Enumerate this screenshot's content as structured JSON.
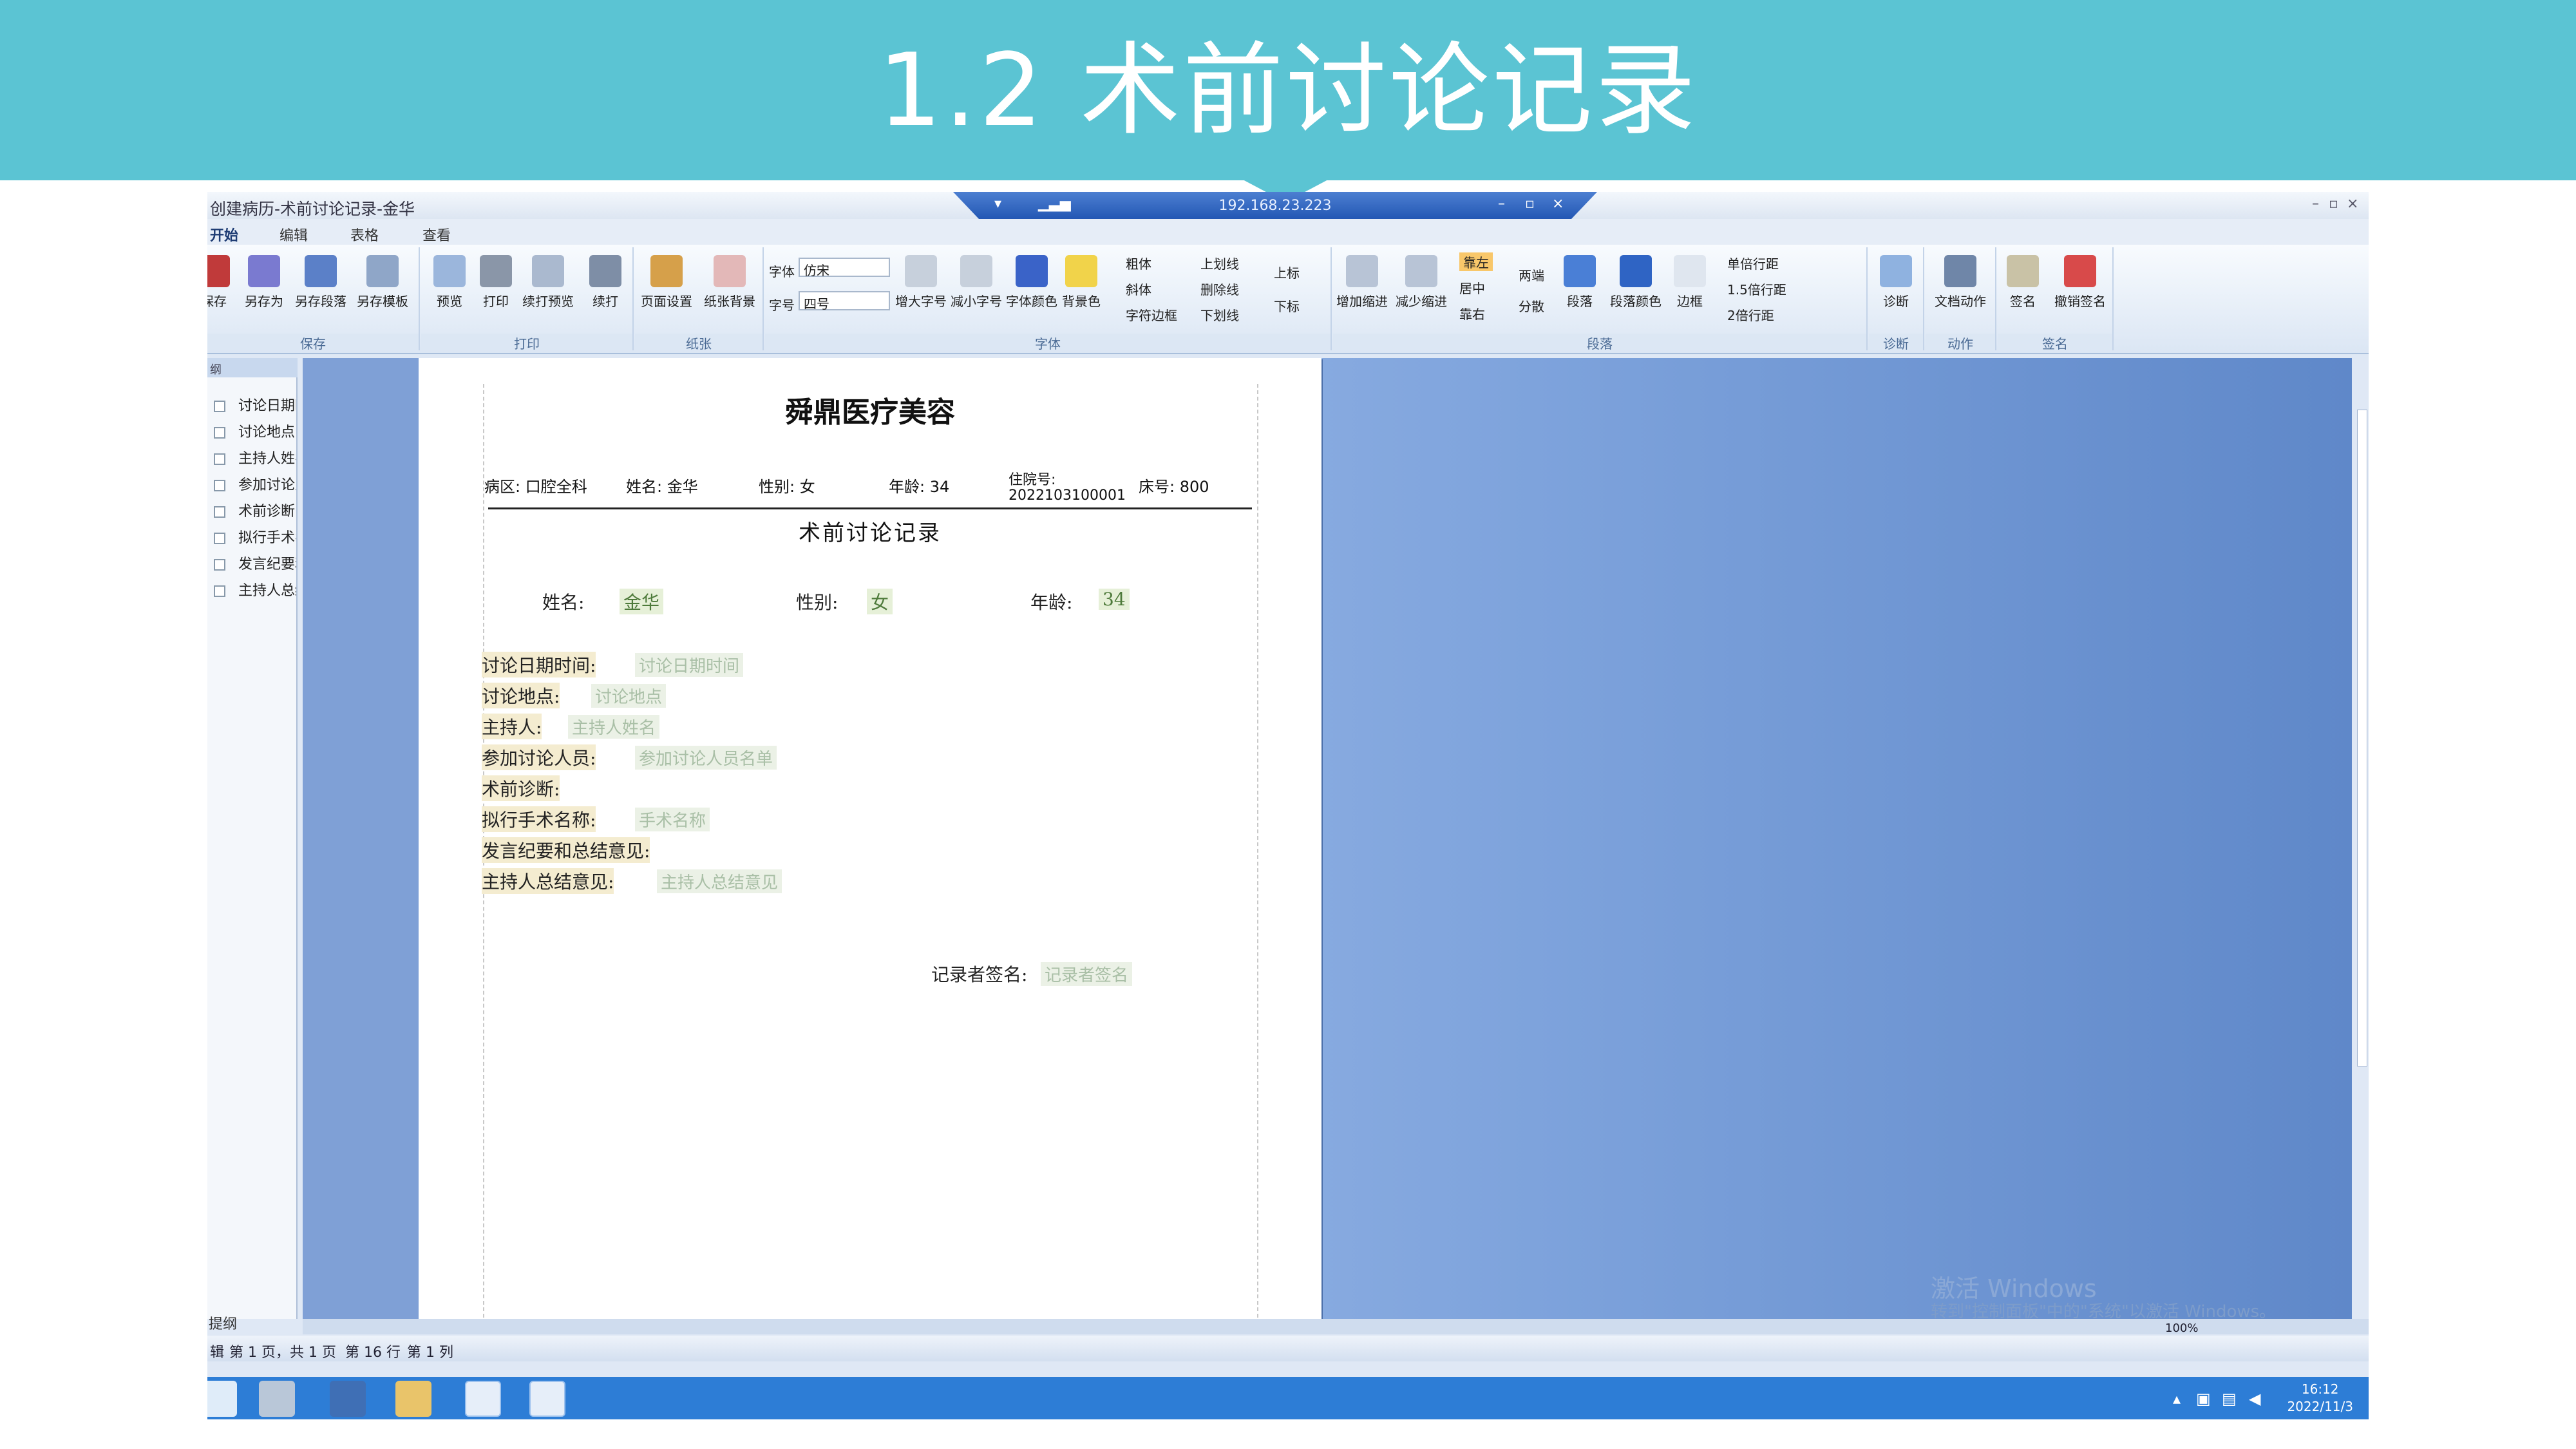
{
  "slide": {
    "title": "1.2 术前讨论记录"
  },
  "window": {
    "title": "创建病历-术前讨论记录-金华",
    "min": "–",
    "restore": "▫",
    "close": "×"
  },
  "remote": {
    "ip": "192.168.23.223",
    "pin": "▾",
    "signal": "▁▃▅",
    "min": "–",
    "restore": "▫",
    "close": "×"
  },
  "menu_tabs": [
    "开始",
    "编辑",
    "表格",
    "查看"
  ],
  "ribbon": {
    "save_group": {
      "label": "保存",
      "buttons": [
        "保存",
        "另存为",
        "另存段落",
        "另存模板"
      ]
    },
    "print_group": {
      "label": "打印",
      "buttons": [
        "预览",
        "打印",
        "续打预览",
        "续打"
      ]
    },
    "paper_group": {
      "label": "纸张",
      "buttons": [
        "页面设置",
        "纸张背景"
      ]
    },
    "font_group": {
      "label": "字体",
      "font_label": "字体",
      "font_value": "仿宋",
      "size_label": "字号",
      "size_value": "四号",
      "buttons": [
        "增大字号",
        "减小字号",
        "字体颜色",
        "背景色"
      ],
      "styles": [
        "粗体",
        "斜体",
        "字符边框",
        "上划线",
        "删除线",
        "下划线",
        "上标",
        "下标"
      ]
    },
    "para_group": {
      "label": "段落",
      "buttons": [
        "增加缩进",
        "减少缩进",
        "靠左",
        "居中",
        "靠右",
        "两端",
        "分散",
        "段落",
        "段落颜色",
        "边框"
      ],
      "spacing": [
        "单倍行距",
        "1.5倍行距",
        "2倍行距"
      ]
    },
    "diag_group": {
      "label": "诊断",
      "button": "诊断"
    },
    "action_group": {
      "label": "动作",
      "button": "文档动作"
    },
    "sign_group": {
      "label": "签名",
      "buttons": [
        "签名",
        "撤销签名"
      ]
    }
  },
  "sidebar": {
    "header": "纲",
    "items": [
      "讨论日期时间",
      "讨论地点",
      "主持人姓名",
      "参加讨论人员",
      "术前诊断",
      "拟行手术名称",
      "发言纪要和总结意见",
      "主持人总结意见"
    ],
    "footer": "提纲"
  },
  "document": {
    "hospital": "舜鼎医疗美容",
    "info": {
      "ward": "病区: 口腔全科",
      "name": "姓名: 金华",
      "gender": "性别: 女",
      "age": "年龄: 34",
      "admission": "住院号: 2022103100001",
      "bed": "床号: 800"
    },
    "title": "术前讨论记录",
    "patient": {
      "name_label": "姓名:",
      "name": "金华",
      "gender_label": "性别:",
      "gender": "女",
      "age_label": "年龄:",
      "age": "34"
    },
    "fields": [
      {
        "label": "讨论日期时间:",
        "placeholder": "讨论日期时间"
      },
      {
        "label": "讨论地点:",
        "placeholder": "讨论地点"
      },
      {
        "label": "主持人:",
        "placeholder": "主持人姓名"
      },
      {
        "label": "参加讨论人员:",
        "placeholder": "参加讨论人员名单"
      },
      {
        "label": "术前诊断:",
        "placeholder": ""
      },
      {
        "label": "拟行手术名称:",
        "placeholder": "手术名称"
      },
      {
        "label": "发言纪要和总结意见:",
        "placeholder": ""
      },
      {
        "label": "主持人总结意见:",
        "placeholder": "主持人总结意见"
      }
    ],
    "signature": {
      "label": "记录者签名:",
      "placeholder": "记录者签名"
    }
  },
  "watermark": {
    "line1": "激活 Windows",
    "line2": "转到\"控制面板\"中的\"系统\"以激活 Windows。"
  },
  "zoom": "100%",
  "status": {
    "page": "第 1 页，共 1 页",
    "row": "第 16 行",
    "col": "第 1 列",
    "prefix": "辑"
  },
  "taskbar": {
    "time": "16:12",
    "date": "2022/11/3"
  },
  "colors": {
    "banner": "#5bc4d3",
    "taskbar": "#2d7dd6",
    "field_value": "#4d7a3a",
    "placeholder": "#a9bfa6"
  }
}
